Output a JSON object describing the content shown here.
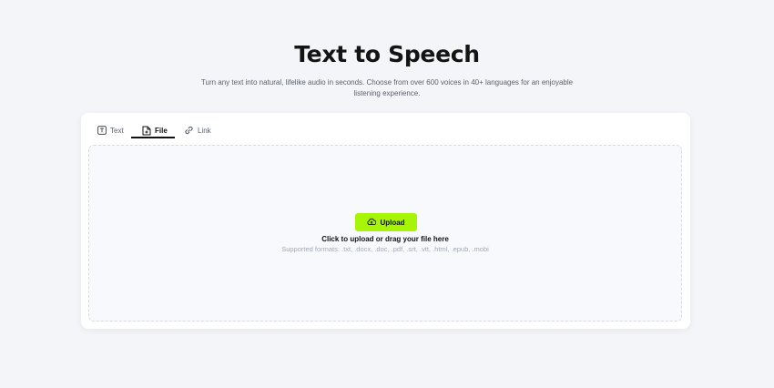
{
  "header": {
    "title": "Text to Speech",
    "subtitle": "Turn any text into natural, lifelike audio in seconds. Choose from over 600 voices in 40+ languages for an enjoyable listening experience."
  },
  "tabs": [
    {
      "label": "Text",
      "icon": "text-icon",
      "active": false
    },
    {
      "label": "File",
      "icon": "file-icon",
      "active": true
    },
    {
      "label": "Link",
      "icon": "link-icon",
      "active": false
    }
  ],
  "upload": {
    "button_label": "Upload",
    "button_icon": "cloud-upload-icon",
    "instruction": "Click to upload or drag your file here",
    "formats": "Supported formats: .txt, .docx, .doc, .pdf, .srt, .vtt, .html, .epub, .mobi"
  },
  "colors": {
    "accent": "#a6f507",
    "background": "#f4f5f8",
    "card": "#ffffff",
    "dropzone": "#f8f9fd"
  }
}
